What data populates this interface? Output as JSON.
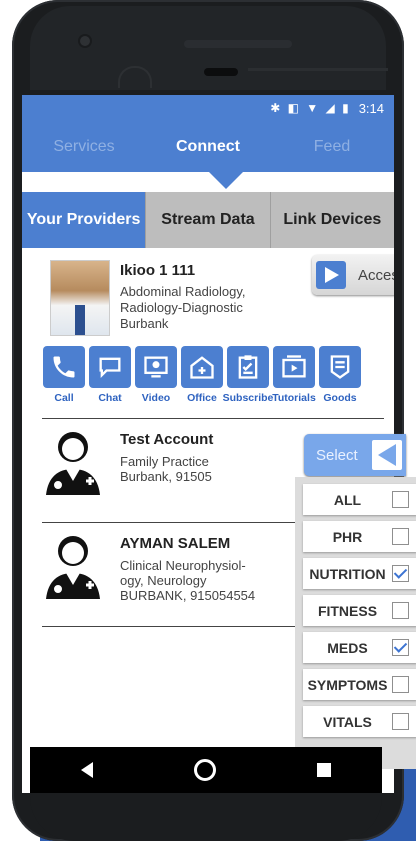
{
  "status": {
    "icons": "✱ ◧ ▼ ◢ ▮",
    "time": "3:14"
  },
  "topnav": {
    "tabs": [
      {
        "label": "Services"
      },
      {
        "label": "Connect"
      },
      {
        "label": "Feed"
      }
    ]
  },
  "subtabs": [
    {
      "label": "Your Providers"
    },
    {
      "label": "Stream Data"
    },
    {
      "label": "Link Devices"
    }
  ],
  "featured_provider": {
    "name": "Ikioo 1 111",
    "specialty_1": "Abdominal Radiology,",
    "specialty_2": "Radiology-Diagnostic",
    "city": "Burbank",
    "access_label": "Access",
    "actions": [
      {
        "label": "Call",
        "icon": "phone-icon"
      },
      {
        "label": "Chat",
        "icon": "chat-icon"
      },
      {
        "label": "Video",
        "icon": "video-icon"
      },
      {
        "label": "Office",
        "icon": "office-icon"
      },
      {
        "label": "Subscribe",
        "icon": "clipboard-icon"
      },
      {
        "label": "Tutorials",
        "icon": "play-icon"
      },
      {
        "label": "Goods",
        "icon": "tag-icon"
      }
    ]
  },
  "providers": [
    {
      "name": "Test Account",
      "line1": "Family Practice",
      "line2": "Burbank, 91505"
    },
    {
      "name": "AYMAN SALEM",
      "line1": "Clinical Neurophysiol-",
      "line2": "ogy, Neurology",
      "line3": "BURBANK, 915054554"
    }
  ],
  "select_label": "Select",
  "filters": [
    {
      "label": "ALL",
      "checked": false
    },
    {
      "label": "PHR",
      "checked": false
    },
    {
      "label": "NUTRITION",
      "checked": true
    },
    {
      "label": "FITNESS",
      "checked": false
    },
    {
      "label": "MEDS",
      "checked": true
    },
    {
      "label": "SYMPTOMS",
      "checked": false
    },
    {
      "label": "VITALS",
      "checked": false
    }
  ],
  "colors": {
    "primary": "#4c7fd0",
    "tab_inactive": "#bdbdbd",
    "select": "#79a7ea"
  }
}
